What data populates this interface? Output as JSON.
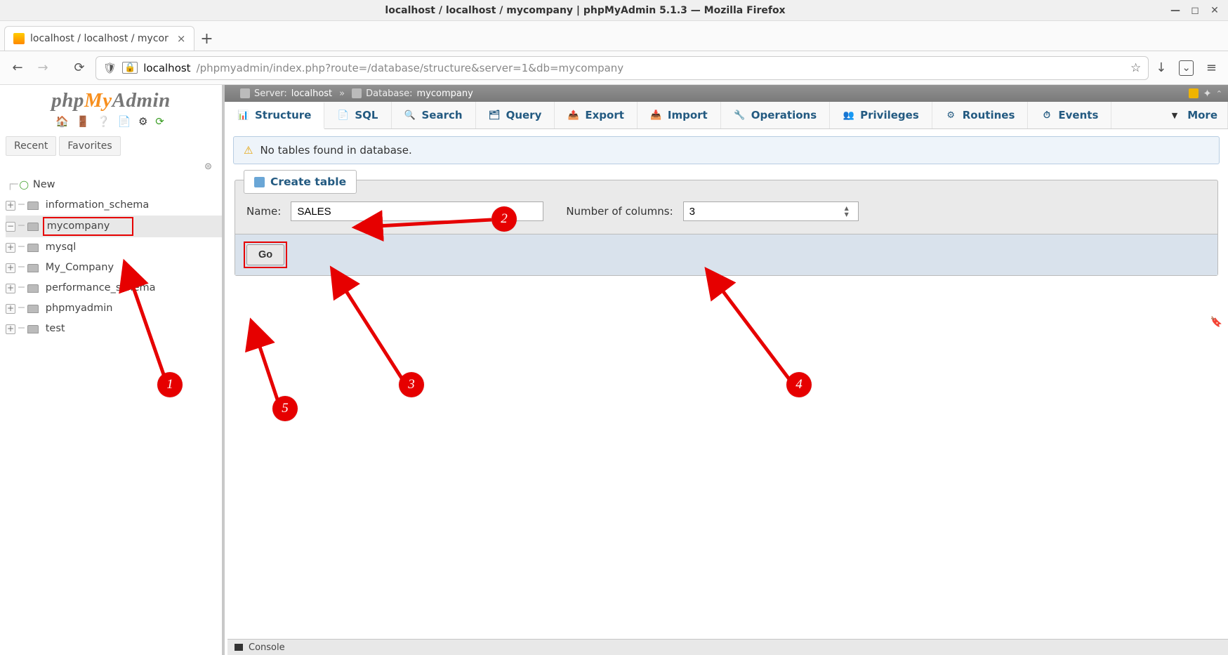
{
  "os": {
    "title": "localhost / localhost / mycompany | phpMyAdmin 5.1.3 — Mozilla Firefox"
  },
  "browser": {
    "tab_title": "localhost / localhost / mycor",
    "url_host": "localhost",
    "url_path": "/phpmyadmin/index.php?route=/database/structure&server=1&db=mycompany"
  },
  "sidebar": {
    "logo": {
      "a": "php",
      "b": "My",
      "c": "Admin"
    },
    "tabs": {
      "recent": "Recent",
      "favorites": "Favorites"
    },
    "new_label": "New",
    "databases": [
      {
        "label": "information_schema",
        "expanded": false,
        "selected": false
      },
      {
        "label": "mycompany",
        "expanded": true,
        "selected": true
      },
      {
        "label": "mysql",
        "expanded": false,
        "selected": false
      },
      {
        "label": "My_Company",
        "expanded": false,
        "selected": false
      },
      {
        "label": "performance_schema",
        "expanded": false,
        "selected": false
      },
      {
        "label": "phpmyadmin",
        "expanded": false,
        "selected": false
      },
      {
        "label": "test",
        "expanded": false,
        "selected": false
      }
    ]
  },
  "breadcrumb": {
    "server_lbl": "Server:",
    "server_val": "localhost",
    "db_lbl": "Database:",
    "db_val": "mycompany"
  },
  "tabs": {
    "structure": "Structure",
    "sql": "SQL",
    "search": "Search",
    "query": "Query",
    "export": "Export",
    "import": "Import",
    "operations": "Operations",
    "privileges": "Privileges",
    "routines": "Routines",
    "events": "Events",
    "more": "More"
  },
  "notice": {
    "text": "No tables found in database."
  },
  "create_table": {
    "legend": "Create table",
    "name_label": "Name:",
    "name_value": "SALES",
    "cols_label": "Number of columns:",
    "cols_value": "3",
    "go_label": "Go"
  },
  "console_label": "Console",
  "annotations": {
    "n1": "1",
    "n2": "2",
    "n3": "3",
    "n4": "4",
    "n5": "5"
  }
}
